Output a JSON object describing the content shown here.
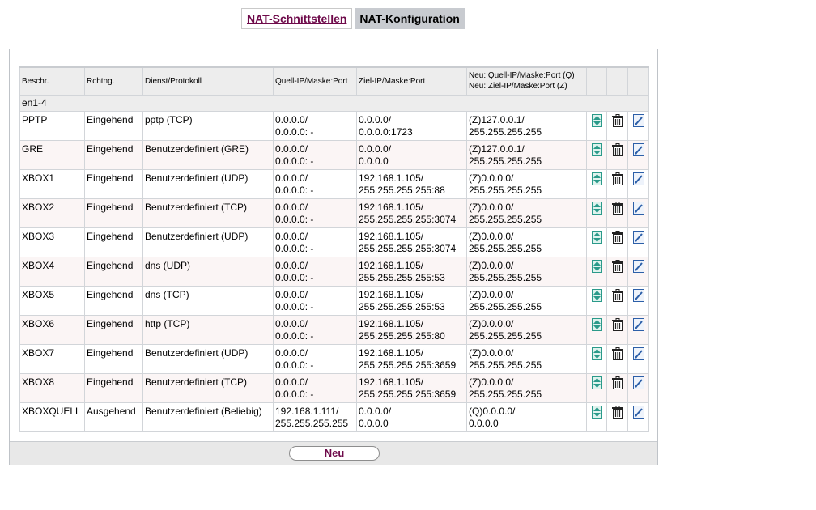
{
  "tabs": [
    {
      "label": "NAT-Schnittstellen",
      "active": false
    },
    {
      "label": "NAT-Konfiguration",
      "active": true
    }
  ],
  "table": {
    "headers": {
      "beschr": "Beschr.",
      "rchtng": "Rchtng.",
      "dienst": "Dienst/Protokoll",
      "quell": "Quell-IP/Maske:Port",
      "ziel": "Ziel-IP/Maske:Port",
      "neu_line1": "Neu: Quell-IP/Maske:Port (Q)",
      "neu_line2": "Neu: Ziel-IP/Maske:Port (Z)"
    },
    "group": "en1-4",
    "rows": [
      {
        "beschr": "PPTP",
        "rchtng": "Eingehend",
        "dienst": "pptp (TCP)",
        "quell1": "0.0.0.0/",
        "quell2": "0.0.0.0: -",
        "ziel1": "0.0.0.0/",
        "ziel2": "0.0.0.0:1723",
        "neu1": "(Z)127.0.0.1/",
        "neu2": "255.255.255.255"
      },
      {
        "beschr": "GRE",
        "rchtng": "Eingehend",
        "dienst": "Benutzerdefiniert (GRE)",
        "quell1": "0.0.0.0/",
        "quell2": "0.0.0.0: -",
        "ziel1": "0.0.0.0/",
        "ziel2": "0.0.0.0",
        "neu1": "(Z)127.0.0.1/",
        "neu2": "255.255.255.255"
      },
      {
        "beschr": "XBOX1",
        "rchtng": "Eingehend",
        "dienst": "Benutzerdefiniert (UDP)",
        "quell1": "0.0.0.0/",
        "quell2": "0.0.0.0: -",
        "ziel1": "192.168.1.105/",
        "ziel2": "255.255.255.255:88",
        "neu1": "(Z)0.0.0.0/",
        "neu2": "255.255.255.255"
      },
      {
        "beschr": "XBOX2",
        "rchtng": "Eingehend",
        "dienst": "Benutzerdefiniert (TCP)",
        "quell1": "0.0.0.0/",
        "quell2": "0.0.0.0: -",
        "ziel1": "192.168.1.105/",
        "ziel2": "255.255.255.255:3074",
        "neu1": "(Z)0.0.0.0/",
        "neu2": "255.255.255.255"
      },
      {
        "beschr": "XBOX3",
        "rchtng": "Eingehend",
        "dienst": "Benutzerdefiniert (UDP)",
        "quell1": "0.0.0.0/",
        "quell2": "0.0.0.0: -",
        "ziel1": "192.168.1.105/",
        "ziel2": "255.255.255.255:3074",
        "neu1": "(Z)0.0.0.0/",
        "neu2": "255.255.255.255"
      },
      {
        "beschr": "XBOX4",
        "rchtng": "Eingehend",
        "dienst": "dns (UDP)",
        "quell1": "0.0.0.0/",
        "quell2": "0.0.0.0: -",
        "ziel1": "192.168.1.105/",
        "ziel2": "255.255.255.255:53",
        "neu1": "(Z)0.0.0.0/",
        "neu2": "255.255.255.255"
      },
      {
        "beschr": "XBOX5",
        "rchtng": "Eingehend",
        "dienst": "dns (TCP)",
        "quell1": "0.0.0.0/",
        "quell2": "0.0.0.0: -",
        "ziel1": "192.168.1.105/",
        "ziel2": "255.255.255.255:53",
        "neu1": "(Z)0.0.0.0/",
        "neu2": "255.255.255.255"
      },
      {
        "beschr": "XBOX6",
        "rchtng": "Eingehend",
        "dienst": "http (TCP)",
        "quell1": "0.0.0.0/",
        "quell2": "0.0.0.0: -",
        "ziel1": "192.168.1.105/",
        "ziel2": "255.255.255.255:80",
        "neu1": "(Z)0.0.0.0/",
        "neu2": "255.255.255.255"
      },
      {
        "beschr": "XBOX7",
        "rchtng": "Eingehend",
        "dienst": "Benutzerdefiniert (UDP)",
        "quell1": "0.0.0.0/",
        "quell2": "0.0.0.0: -",
        "ziel1": "192.168.1.105/",
        "ziel2": "255.255.255.255:3659",
        "neu1": "(Z)0.0.0.0/",
        "neu2": "255.255.255.255"
      },
      {
        "beschr": "XBOX8",
        "rchtng": "Eingehend",
        "dienst": "Benutzerdefiniert (TCP)",
        "quell1": "0.0.0.0/",
        "quell2": "0.0.0.0: -",
        "ziel1": "192.168.1.105/",
        "ziel2": "255.255.255.255:3659",
        "neu1": "(Z)0.0.0.0/",
        "neu2": "255.255.255.255"
      },
      {
        "beschr": "XBOXQUELL",
        "rchtng": "Ausgehend",
        "dienst": "Benutzerdefiniert (Beliebig)",
        "quell1": "192.168.1.111/",
        "quell2": "255.255.255.255",
        "ziel1": "0.0.0.0/",
        "ziel2": "0.0.0.0",
        "neu1": "(Q)0.0.0.0/",
        "neu2": "0.0.0.0"
      }
    ],
    "row_icons": [
      "move-icon",
      "trash-icon",
      "edit-icon"
    ]
  },
  "footer": {
    "new_button": "Neu"
  },
  "colors": {
    "accent": "#6e0a4a",
    "header_bg": "#ededed",
    "odd_row_bg": "#fbf5f5",
    "active_tab_bg": "#c8cbd0",
    "icon_teal": "#2a9a8a",
    "icon_blue": "#2c5fa8"
  }
}
